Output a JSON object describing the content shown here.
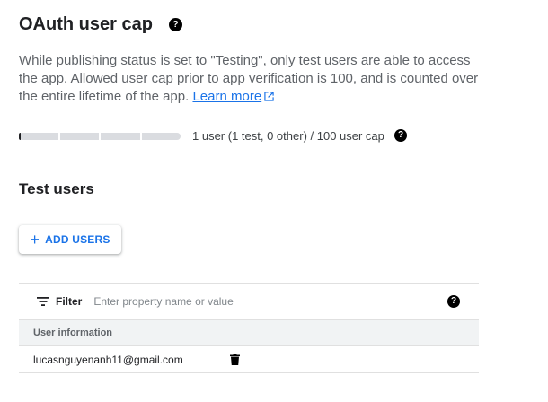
{
  "cap_section": {
    "title": "OAuth user cap",
    "description": "While publishing status is set to \"Testing\", only test users are able to access the app. Allowed user cap prior to app verification is 100, and is counted over the entire lifetime of the app.",
    "learn_more": "Learn more",
    "help_icon": "help-icon",
    "progress": {
      "used": 1,
      "cap": 100
    },
    "usage_text": "1 user (1 test, 0 other) / 100 user cap"
  },
  "test_users": {
    "title": "Test users",
    "add_button": {
      "icon": "plus-icon",
      "label": "ADD USERS"
    },
    "filter": {
      "icon": "filter-icon",
      "label": "Filter",
      "placeholder": "Enter property name or value",
      "value": ""
    },
    "columns": [
      "User information"
    ],
    "rows": [
      {
        "email": "lucasnguyenanh11@gmail.com",
        "action_icon": "trash-icon"
      }
    ]
  },
  "colors": {
    "accent": "#1a73e8",
    "text_primary": "#202124",
    "text_secondary": "#5f6368",
    "header_bg": "#f1f3f4",
    "divider": "#e0e0e0"
  }
}
